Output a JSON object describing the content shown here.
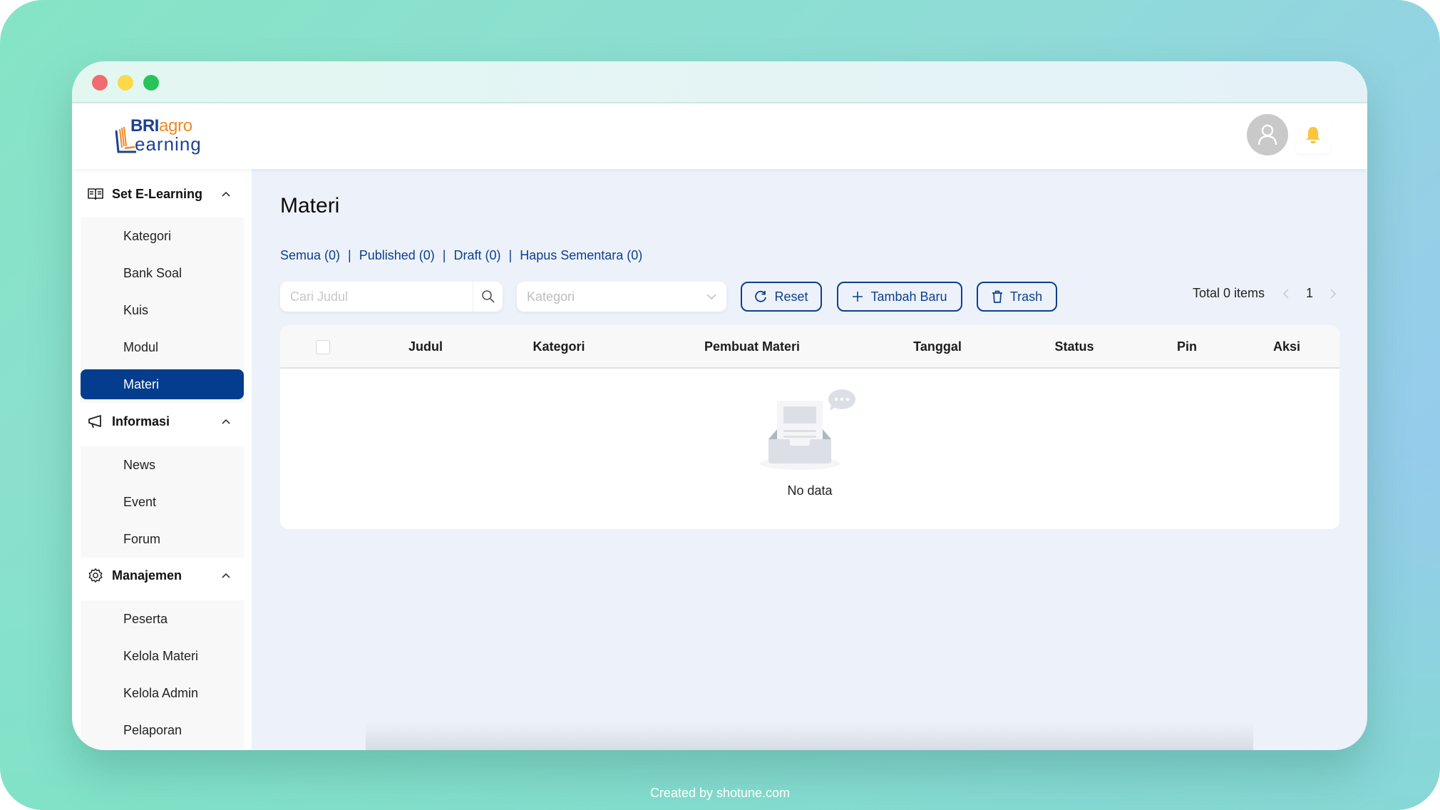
{
  "window": {
    "controls": [
      "close",
      "minimize",
      "maximize"
    ]
  },
  "header": {
    "logo": {
      "part1": "BRI",
      "part2": "agro",
      "part3": "earning",
      "alt": "BRIagro Learning"
    },
    "avatar_icon": "user-icon",
    "notification_icon": "bell-icon"
  },
  "sidebar": {
    "groups": [
      {
        "label": "Set E-Learning",
        "icon": "book-open-icon",
        "expanded": true,
        "items": [
          {
            "label": "Kategori"
          },
          {
            "label": "Bank Soal"
          },
          {
            "label": "Kuis"
          },
          {
            "label": "Modul"
          },
          {
            "label": "Materi",
            "active": true
          }
        ]
      },
      {
        "label": "Informasi",
        "icon": "megaphone-icon",
        "expanded": true,
        "items": [
          {
            "label": "News"
          },
          {
            "label": "Event"
          },
          {
            "label": "Forum"
          }
        ]
      },
      {
        "label": "Manajemen",
        "icon": "gear-icon",
        "expanded": true,
        "items": [
          {
            "label": "Peserta"
          },
          {
            "label": "Kelola Materi"
          },
          {
            "label": "Kelola Admin"
          },
          {
            "label": "Pelaporan"
          }
        ]
      }
    ]
  },
  "main": {
    "title": "Materi",
    "filters": [
      {
        "label": "Semua (0)"
      },
      {
        "label": "Published (0)"
      },
      {
        "label": "Draft (0)"
      },
      {
        "label": "Hapus Sementara (0)"
      }
    ],
    "filter_separator": "|",
    "search": {
      "placeholder": "Cari Judul",
      "value": ""
    },
    "category_select": {
      "placeholder": "Kategori"
    },
    "buttons": {
      "reset": "Reset",
      "add": "Tambah Baru",
      "trash": "Trash"
    },
    "pagination": {
      "total": "Total 0 items",
      "current_page": "1"
    },
    "table": {
      "columns": [
        "Judul",
        "Kategori",
        "Pembuat Materi",
        "Tanggal",
        "Status",
        "Pin",
        "Aksi"
      ],
      "rows": [],
      "empty_text": "No data"
    }
  },
  "colors": {
    "primary": "#043c8e",
    "link": "#0d3e8f",
    "bell": "#fbc638",
    "logo_blue": "#1d4192",
    "logo_orange": "#f08a24",
    "content_bg": "#edf2fa"
  },
  "footer": {
    "credit": "Created by shotune.com"
  }
}
